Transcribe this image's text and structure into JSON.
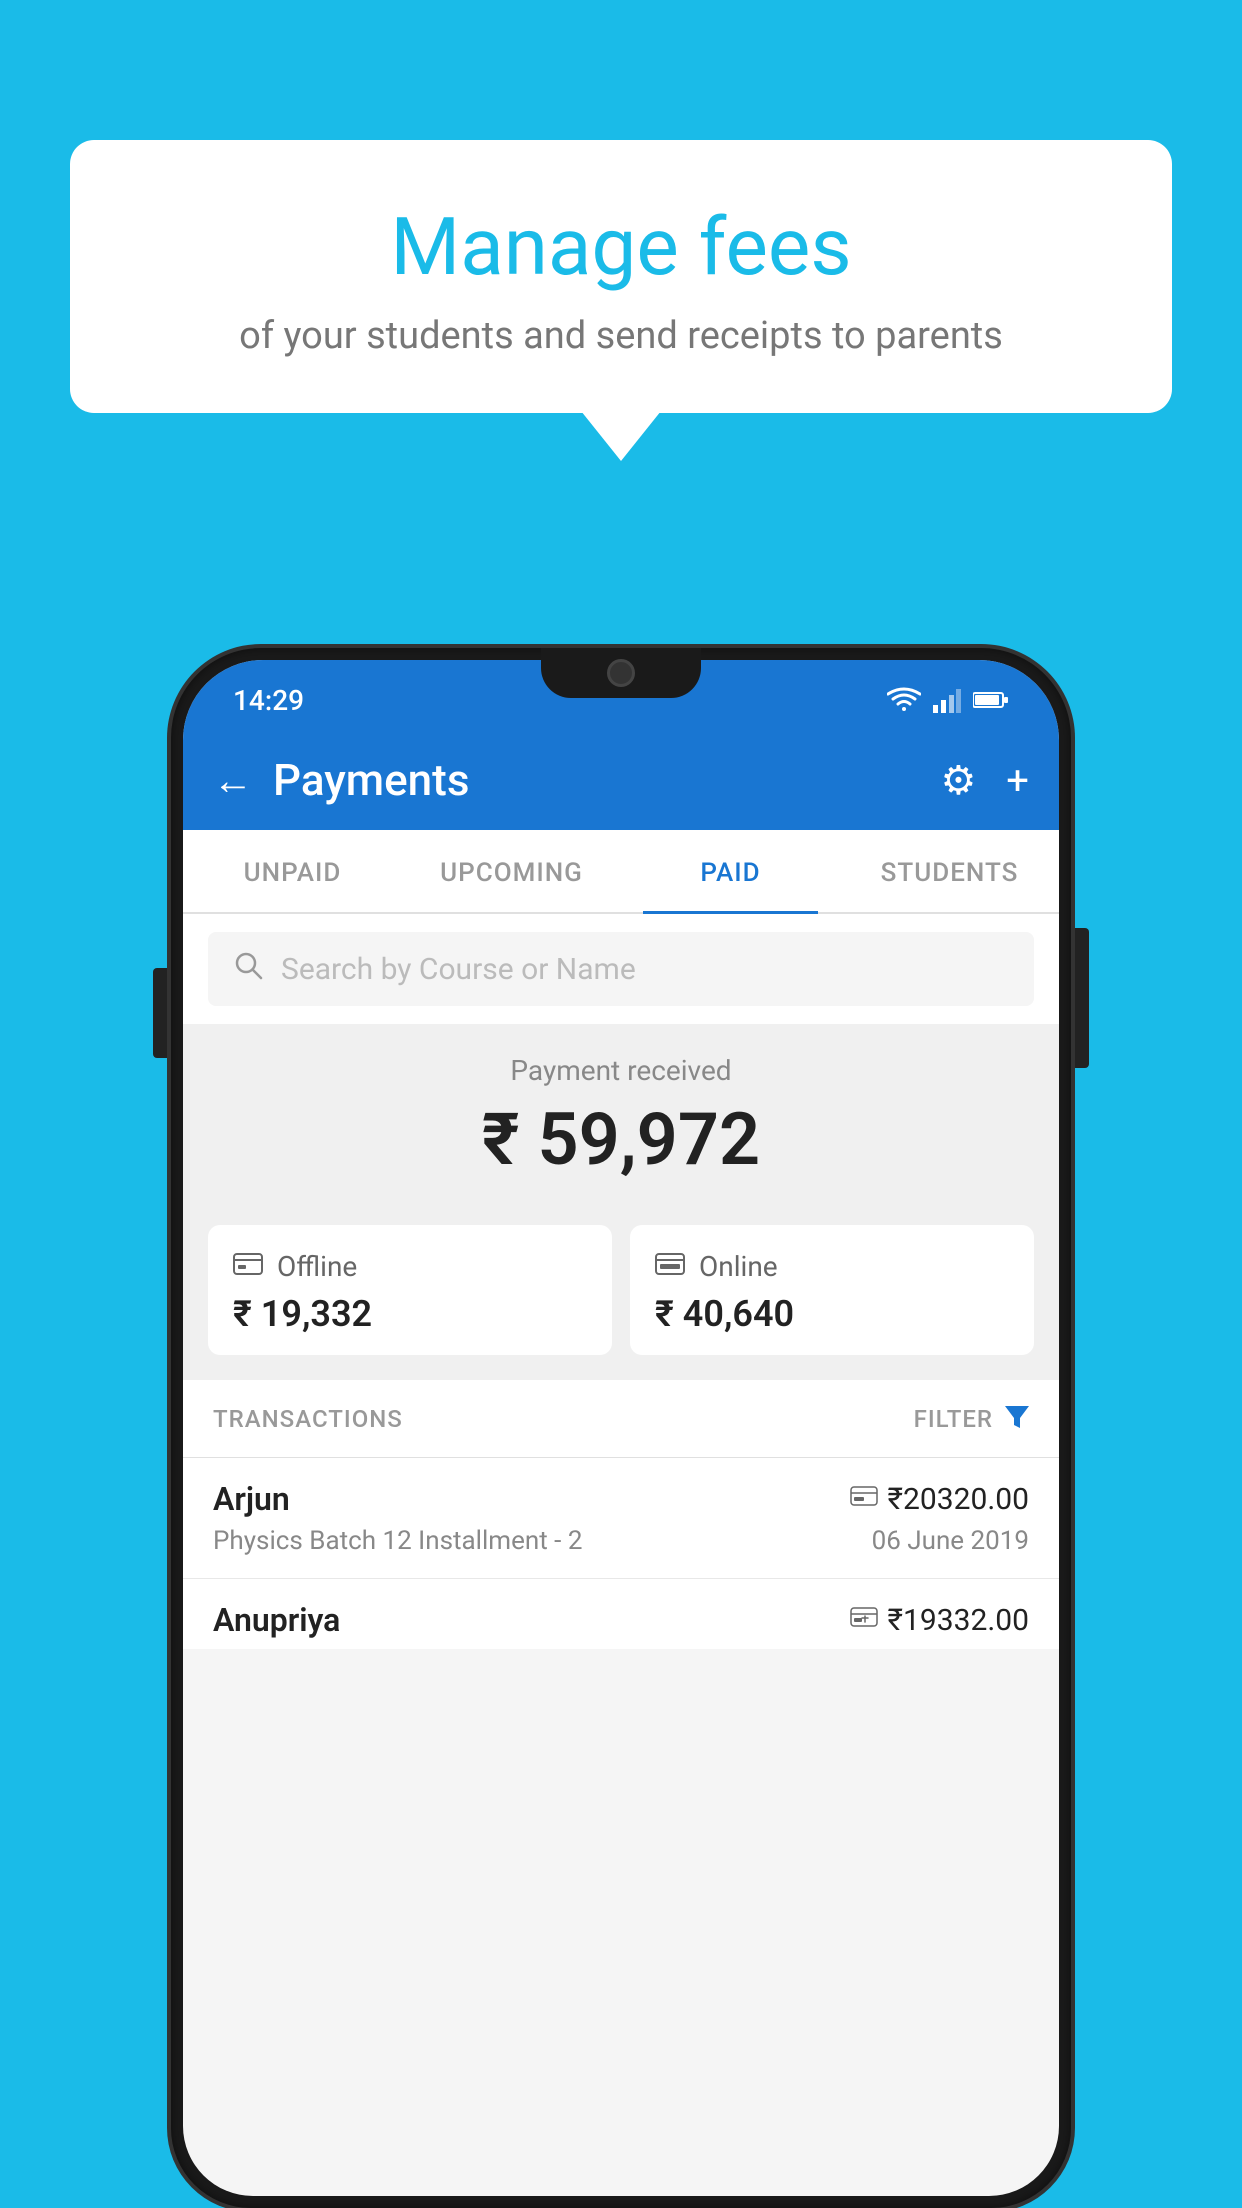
{
  "background_color": "#1ABBE8",
  "speech_bubble": {
    "title": "Manage fees",
    "subtitle": "of your students and send receipts to parents"
  },
  "status_bar": {
    "time": "14:29",
    "icons": [
      "wifi",
      "signal",
      "battery"
    ]
  },
  "header": {
    "title": "Payments",
    "back_label": "←",
    "gear_label": "⚙",
    "plus_label": "+"
  },
  "tabs": [
    {
      "label": "UNPAID",
      "active": false
    },
    {
      "label": "UPCOMING",
      "active": false
    },
    {
      "label": "PAID",
      "active": true
    },
    {
      "label": "STUDENTS",
      "active": false
    }
  ],
  "search": {
    "placeholder": "Search by Course or Name"
  },
  "payment_received": {
    "label": "Payment received",
    "amount": "₹ 59,972"
  },
  "payment_cards": [
    {
      "icon": "offline",
      "label": "Offline",
      "amount": "₹ 19,332"
    },
    {
      "icon": "online",
      "label": "Online",
      "amount": "₹ 40,640"
    }
  ],
  "transactions_section": {
    "label": "TRANSACTIONS",
    "filter_label": "FILTER"
  },
  "transactions": [
    {
      "name": "Arjun",
      "course": "Physics Batch 12 Installment - 2",
      "amount": "₹20320.00",
      "date": "06 June 2019",
      "type": "online"
    },
    {
      "name": "Anupriya",
      "course": "",
      "amount": "₹19332.00",
      "date": "",
      "type": "offline"
    }
  ]
}
